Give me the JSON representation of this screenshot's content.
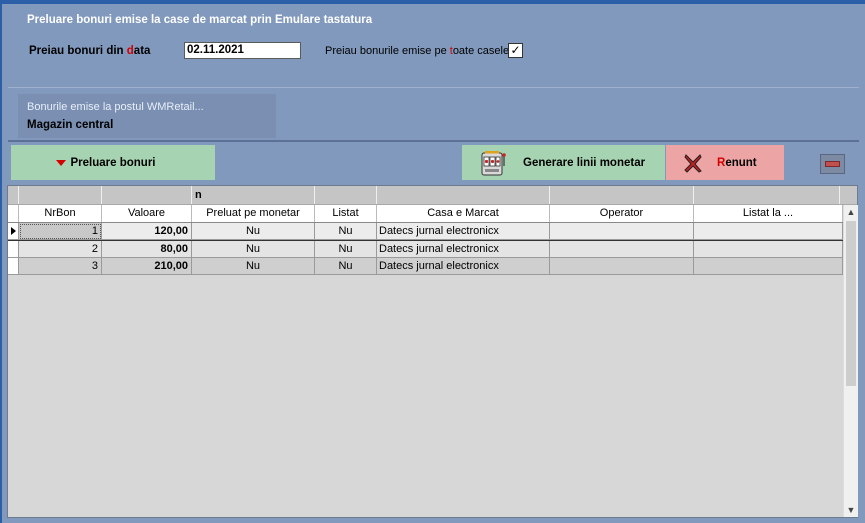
{
  "window": {
    "title": "Preluare bonuri emise la case de marcat prin Emulare tastatura"
  },
  "filters": {
    "date_label_part1": "Preiau bonuri din ",
    "date_label_accent": "d",
    "date_label_part2": "ata",
    "date_value": "02.11.2021",
    "all_label_part1": "Preiau bonurile emise pe ",
    "all_label_accent": "t",
    "all_label_part2": "oate casele",
    "all_checked": "✓"
  },
  "info": {
    "line1": "Bonurile emise la postul WMRetail...",
    "line2": "Magazin central"
  },
  "toolbar": {
    "preluare_label": "Preluare bonuri",
    "generare_label": "Generare linii monetar",
    "renunt_accent": "R",
    "renunt_rest": "enunt"
  },
  "grid": {
    "band_label": "n",
    "columns": [
      "NrBon",
      "Valoare",
      "Preluat pe monetar",
      "Listat",
      "Casa e Marcat",
      "Operator",
      "Listat la ..."
    ],
    "rows": [
      {
        "nrbon": "1",
        "valoare": "120,00",
        "preluat": "Nu",
        "listat": "Nu",
        "casa": "Datecs jurnal electronicx",
        "operator": "",
        "listat_la": ""
      },
      {
        "nrbon": "2",
        "valoare": "80,00",
        "preluat": "Nu",
        "listat": "Nu",
        "casa": "Datecs jurnal electronicx",
        "operator": "",
        "listat_la": ""
      },
      {
        "nrbon": "3",
        "valoare": "210,00",
        "preluat": "Nu",
        "listat": "Nu",
        "casa": "Datecs jurnal electronicx",
        "operator": "",
        "listat_la": ""
      }
    ]
  },
  "colors": {
    "window_bg": "#8199bd",
    "green_button": "#a6d4b2",
    "red_button": "#eda4a4",
    "accent": "#d40000"
  },
  "icons": {
    "preluare": "down-triangle-icon",
    "generare": "slot-machine-icon",
    "renunt": "red-x-icon",
    "minimize": "minus-icon"
  }
}
